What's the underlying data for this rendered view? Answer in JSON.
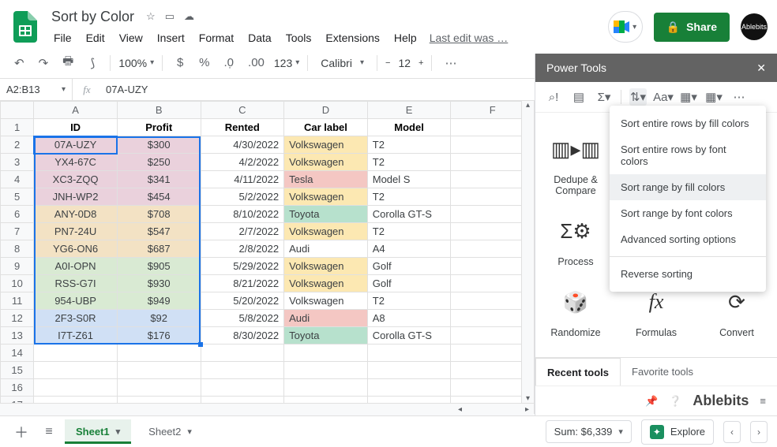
{
  "doc": {
    "title": "Sort by Color",
    "last_edit": "Last edit was …"
  },
  "menu": {
    "file": "File",
    "edit": "Edit",
    "view": "View",
    "insert": "Insert",
    "format": "Format",
    "data": "Data",
    "tools": "Tools",
    "extensions": "Extensions",
    "help": "Help"
  },
  "share": {
    "label": "Share"
  },
  "avatar": {
    "label": "Ablebits"
  },
  "toolbar": {
    "zoom": "100%",
    "fmt123": "123",
    "font": "Calibri",
    "size": "12"
  },
  "namebox": {
    "ref": "A2:B13"
  },
  "formula": {
    "value": "07A-UZY"
  },
  "columns": [
    "A",
    "B",
    "C",
    "D",
    "E",
    "F"
  ],
  "headers": {
    "id": "ID",
    "profit": "Profit",
    "rented": "Rented",
    "carlabel": "Car label",
    "model": "Model"
  },
  "rows": [
    {
      "n": 2,
      "id": "07A-UZY",
      "profit": "$300",
      "rented": "4/30/2022",
      "label": "Volkswagen",
      "model": "T2",
      "idc": "bg-pink",
      "lc": "bg-vw"
    },
    {
      "n": 3,
      "id": "YX4-67C",
      "profit": "$250",
      "rented": "4/2/2022",
      "label": "Volkswagen",
      "model": "T2",
      "idc": "bg-pink",
      "lc": "bg-vw"
    },
    {
      "n": 4,
      "id": "XC3-ZQQ",
      "profit": "$341",
      "rented": "4/11/2022",
      "label": "Tesla",
      "model": "Model S",
      "idc": "bg-pink",
      "lc": "bg-tesla"
    },
    {
      "n": 5,
      "id": "JNH-WP2",
      "profit": "$454",
      "rented": "5/2/2022",
      "label": "Volkswagen",
      "model": "T2",
      "idc": "bg-pink",
      "lc": "bg-vw"
    },
    {
      "n": 6,
      "id": "ANY-0D8",
      "profit": "$708",
      "rented": "8/10/2022",
      "label": "Toyota",
      "model": "Corolla GT-S",
      "idc": "bg-tan",
      "lc": "bg-toyota"
    },
    {
      "n": 7,
      "id": "PN7-24U",
      "profit": "$547",
      "rented": "2/7/2022",
      "label": "Volkswagen",
      "model": "T2",
      "idc": "bg-tan",
      "lc": "bg-vw"
    },
    {
      "n": 8,
      "id": "YG6-ON6",
      "profit": "$687",
      "rented": "2/8/2022",
      "label": "Audi",
      "model": "A4",
      "idc": "bg-tan",
      "lc": ""
    },
    {
      "n": 9,
      "id": "A0I-OPN",
      "profit": "$905",
      "rented": "5/29/2022",
      "label": "Volkswagen",
      "model": "Golf",
      "idc": "bg-green1",
      "lc": "bg-vw"
    },
    {
      "n": 10,
      "id": "RSS-G7I",
      "profit": "$930",
      "rented": "8/21/2022",
      "label": "Volkswagen",
      "model": "Golf",
      "idc": "bg-green1",
      "lc": "bg-vw"
    },
    {
      "n": 11,
      "id": "954-UBP",
      "profit": "$949",
      "rented": "5/20/2022",
      "label": "Volkswagen",
      "model": "T2",
      "idc": "bg-green1",
      "lc": ""
    },
    {
      "n": 12,
      "id": "2F3-S0R",
      "profit": "$92",
      "rented": "5/8/2022",
      "label": "Audi",
      "model": "A8",
      "idc": "bg-blue1",
      "lc": "bg-audi"
    },
    {
      "n": 13,
      "id": "I7T-Z61",
      "profit": "$176",
      "rented": "8/30/2022",
      "label": "Toyota",
      "model": "Corolla GT-S",
      "idc": "bg-blue1",
      "lc": "bg-toyota"
    }
  ],
  "empty_rows": [
    14,
    15,
    16,
    17
  ],
  "sidepanel": {
    "title": "Power Tools",
    "tools": {
      "dedup": "Dedupe & Compare",
      "process": "Process",
      "randomize": "Randomize",
      "formulas": "Formulas",
      "convert": "Convert"
    },
    "tabs": {
      "recent": "Recent tools",
      "favorite": "Favorite tools"
    },
    "brand": "Ablebits",
    "menu": {
      "i1": "Sort entire rows by fill colors",
      "i2": "Sort entire rows by font colors",
      "i3": "Sort range by fill colors",
      "i4": "Sort range by font colors",
      "i5": "Advanced sorting options",
      "i6": "Reverse sorting"
    }
  },
  "bottom": {
    "sheet1": "Sheet1",
    "sheet2": "Sheet2",
    "sum": "Sum: $6,339",
    "explore": "Explore"
  }
}
